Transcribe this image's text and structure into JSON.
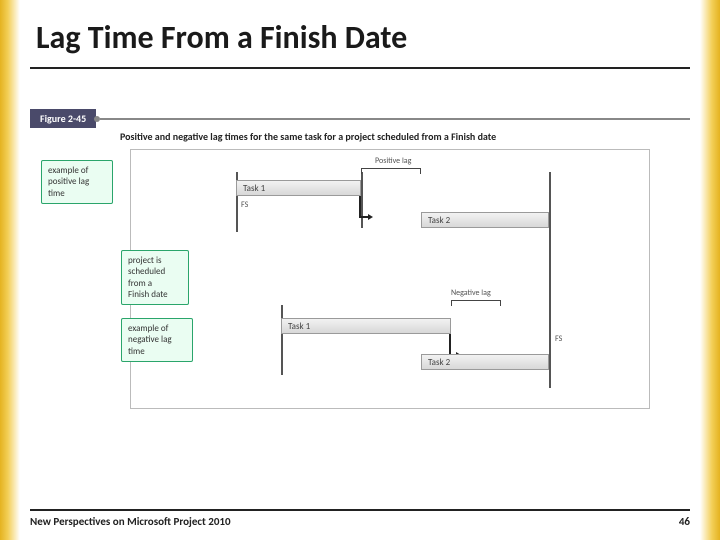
{
  "title": "Lag Time From a Finish Date",
  "figure": {
    "tag": "Figure 2-45",
    "caption": "Positive and negative lag times for the same task for a project scheduled from a Finish date"
  },
  "callouts": {
    "positive": "example of\npositive lag time",
    "scheduled": "project is\nscheduled\nfrom a\nFinish date",
    "negative": "example of\nnegative lag time"
  },
  "labels": {
    "task1": "Task 1",
    "task2": "Task 2",
    "positive_lag": "Positive lag",
    "negative_lag": "Negative lag",
    "fs": "FS"
  },
  "footer": {
    "left": "New Perspectives on Microsoft Project 2010",
    "page": "46"
  }
}
